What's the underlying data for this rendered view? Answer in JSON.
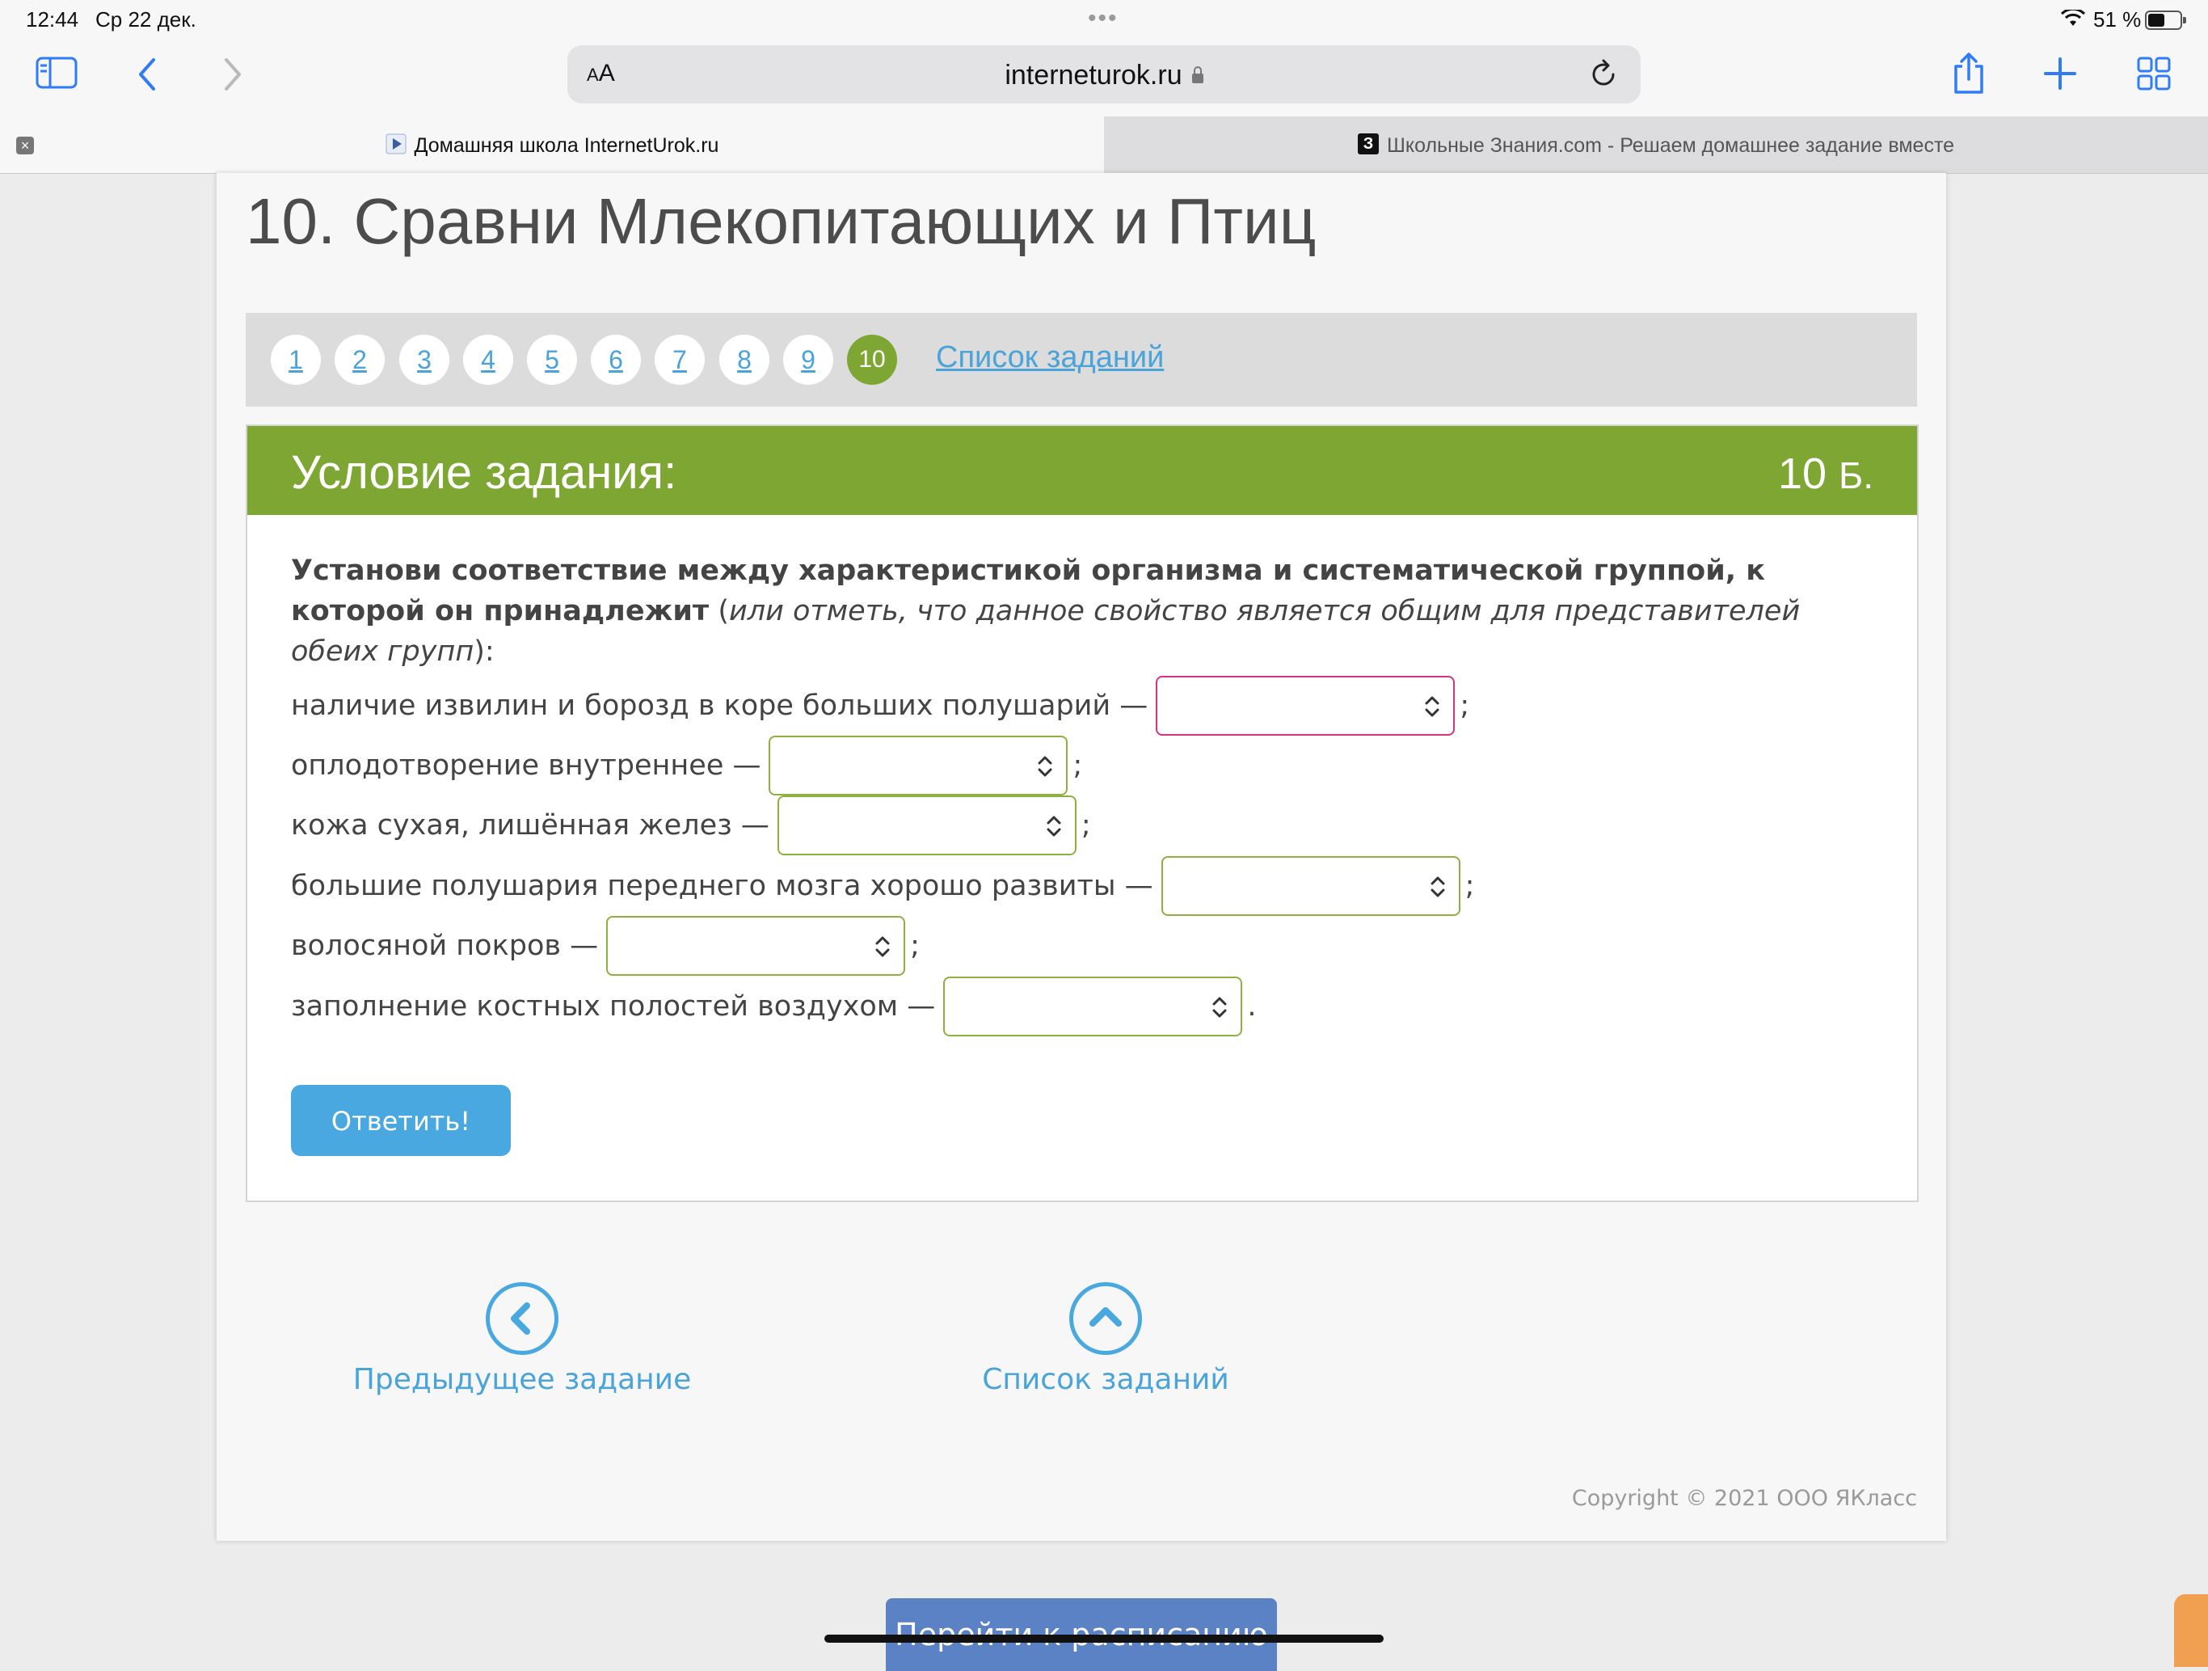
{
  "status_bar": {
    "time": "12:44",
    "date": "Ср 22 дек.",
    "battery": "51 %",
    "battery_level": 0.51
  },
  "browser": {
    "aa_label_small": "A",
    "aa_label_big": "A",
    "url": "interneturok.ru",
    "tabs": [
      {
        "label": "Домашняя школа InternetUrok.ru",
        "active": true
      },
      {
        "label": "Школьные Знания.com - Решаем домашнее задание вместе",
        "active": false
      }
    ],
    "tab_close": "×",
    "favicon_z": "З"
  },
  "page": {
    "title": "10. Сравни Млекопитающих и Птиц",
    "pager": {
      "pages": [
        "1",
        "2",
        "3",
        "4",
        "5",
        "6",
        "7",
        "8",
        "9",
        "10"
      ],
      "active": "10",
      "list_link": "Список заданий"
    },
    "task": {
      "header_title": "Условие задания:",
      "points_value": "10",
      "points_unit": "Б.",
      "instruction_bold": "Установи соответствие между характеристикой организма и систематической группой, к которой он принадлежит",
      "instruction_open": " (",
      "instruction_italic": "или отметь, что данное свойство является общим для представителей обеих групп",
      "instruction_close": "):",
      "rows": [
        {
          "text": "наличие извилин и борозд в коре больших полушарий —",
          "value": "",
          "punct": ";"
        },
        {
          "text": "оплодотворение внутреннее —",
          "value": "",
          "punct": ";"
        },
        {
          "text": "кожа сухая, лишённая желез —",
          "value": "",
          "punct": ";"
        },
        {
          "text": "большие полушария переднего мозга хорошо развиты —",
          "value": "",
          "punct": ";"
        },
        {
          "text": "волосяной покров —",
          "value": "",
          "punct": ";"
        },
        {
          "text": "заполнение костных полостей воздухом —",
          "value": "",
          "punct": "."
        }
      ],
      "answer_button": "Ответить!"
    },
    "nav": {
      "prev": "Предыдущее задание",
      "list": "Список заданий"
    },
    "copyright": "Copyright © 2021 ООО ЯКласс",
    "schedule_button": "Перейти к расписанию"
  },
  "colors": {
    "green": "#7ea632",
    "blue": "#4aa8e0",
    "link": "#4aa3d9",
    "invalid_border": "#d63384"
  }
}
